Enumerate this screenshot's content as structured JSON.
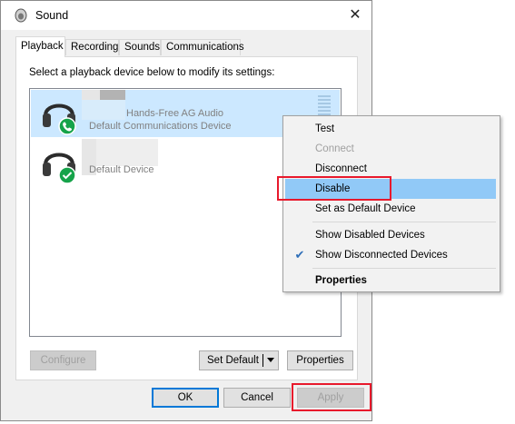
{
  "window": {
    "title": "Sound"
  },
  "tabs": [
    {
      "label": "Playback"
    },
    {
      "label": "Recording"
    },
    {
      "label": "Sounds"
    },
    {
      "label": "Communications"
    }
  ],
  "instruction": "Select a playback device below to modify its settings:",
  "devices": [
    {
      "name": "Hands-Free AG Audio",
      "status": "Default Communications Device",
      "badge": "phone-badge-icon"
    },
    {
      "status": "Default Device",
      "badge": "check-badge-icon"
    }
  ],
  "panel_buttons": {
    "configure": "Configure",
    "set_default": "Set Default",
    "properties": "Properties"
  },
  "dialog_buttons": {
    "ok": "OK",
    "cancel": "Cancel",
    "apply": "Apply"
  },
  "context_menu": {
    "items": [
      {
        "label": "Test"
      },
      {
        "label": "Connect",
        "disabled": true
      },
      {
        "label": "Disconnect"
      },
      {
        "label": "Disable",
        "highlighted": true
      },
      {
        "label": "Set as Default Device"
      },
      {
        "label": "Show Disabled Devices"
      },
      {
        "label": "Show Disconnected Devices",
        "checked": true
      },
      {
        "label": "Properties",
        "bold": true
      }
    ]
  },
  "colors": {
    "accent": "#0078d7",
    "selection": "#cce8ff",
    "menu_highlight": "#91c9f7",
    "annotation_red": "#e8192c",
    "status_green": "#16a34a"
  }
}
